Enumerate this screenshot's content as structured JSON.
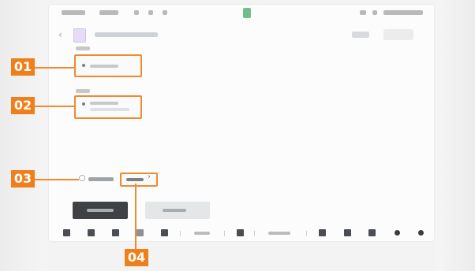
{
  "callouts": [
    {
      "id": "01"
    },
    {
      "id": "02"
    },
    {
      "id": "03"
    },
    {
      "id": "04"
    }
  ],
  "colors": {
    "callout": "#ef7f1a",
    "dark_button": "#3f4145",
    "light_button": "#e4e6e8",
    "screen_bg": "#fcfcfc"
  },
  "icons": [
    "back-icon",
    "app-icon",
    "chevron-right-icon",
    "status-bar-icons",
    "taskbar-icons"
  ]
}
